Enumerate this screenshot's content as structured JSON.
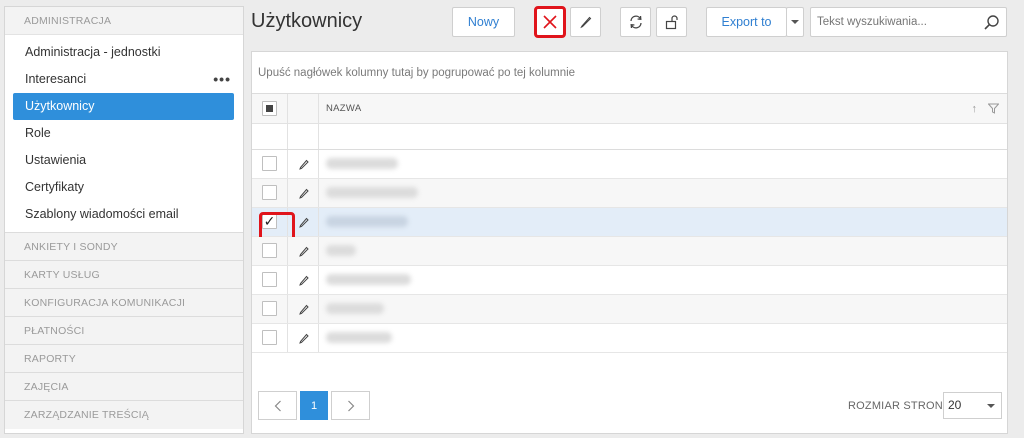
{
  "sidebar": {
    "sections": [
      {
        "label": "ADMINISTRACJA"
      },
      {
        "label": "ANKIETY I SONDY"
      },
      {
        "label": "KARTY USŁUG"
      },
      {
        "label": "KONFIGURACJA KOMUNIKACJI"
      },
      {
        "label": "PŁATNOŚCI"
      },
      {
        "label": "RAPORTY"
      },
      {
        "label": "ZAJĘCIA"
      },
      {
        "label": "ZARZĄDZANIE TREŚCIĄ"
      }
    ],
    "items": [
      {
        "label": "Administracja - jednostki"
      },
      {
        "label": "Interesanci",
        "more": "•••"
      },
      {
        "label": "Użytkownicy",
        "active": true
      },
      {
        "label": "Role"
      },
      {
        "label": "Ustawienia"
      },
      {
        "label": "Certyfikaty"
      },
      {
        "label": "Szablony wiadomości email"
      }
    ]
  },
  "header": {
    "title": "Użytkownicy",
    "new_label": "Nowy",
    "export_label": "Export to",
    "search_placeholder": "Tekst wyszukiwania..."
  },
  "grid": {
    "group_hint": "Upuść nagłówek kolumny tutaj by pogrupować po tej kolumnie",
    "column_name": "NAZWA",
    "sort_glyph": "↑",
    "rows": [
      {
        "checked": false
      },
      {
        "checked": false
      },
      {
        "checked": true
      },
      {
        "checked": false
      },
      {
        "checked": false
      },
      {
        "checked": false
      },
      {
        "checked": false
      }
    ]
  },
  "pager": {
    "prev": "‹",
    "current_page": "1",
    "next": "›",
    "page_size_label": "ROZMIAR STRONY",
    "page_size_value": "20"
  },
  "colors": {
    "accent": "#2f8fdb",
    "highlight": "#e0141b",
    "selected_row": "#e3edf8"
  }
}
